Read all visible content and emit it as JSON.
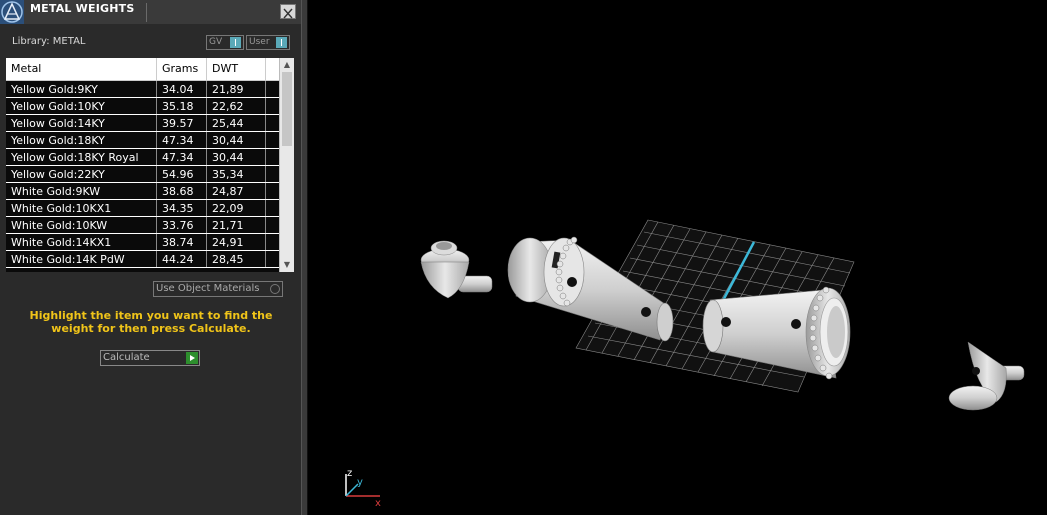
{
  "panel": {
    "title": "METAL WEIGHTS",
    "library_label": "Library: METAL",
    "toggles": [
      "GV",
      "User"
    ],
    "use_object_materials": "Use Object Materials",
    "hint": "Highlight the item you want to find the weight for then press Calculate.",
    "calculate_label": "Calculate"
  },
  "table": {
    "columns": [
      "Metal",
      "Grams",
      "DWT"
    ],
    "rows": [
      [
        "Yellow Gold:9KY",
        "34.04",
        "21,89"
      ],
      [
        "Yellow Gold:10KY",
        "35.18",
        "22,62"
      ],
      [
        "Yellow Gold:14KY",
        "39.57",
        "25,44"
      ],
      [
        "Yellow Gold:18KY",
        "47.34",
        "30,44"
      ],
      [
        "Yellow Gold:18KY Royal",
        "47.34",
        "30,44"
      ],
      [
        "Yellow Gold:22KY",
        "54.96",
        "35,34"
      ],
      [
        "White Gold:9KW",
        "38.68",
        "24,87"
      ],
      [
        "White Gold:10KX1",
        "34.35",
        "22,09"
      ],
      [
        "White Gold:10KW",
        "33.76",
        "21,71"
      ],
      [
        "White Gold:14KX1",
        "38.74",
        "24,91"
      ],
      [
        "White Gold:14K PdW",
        "44.24",
        "28,45"
      ]
    ]
  },
  "viewport": {
    "axis_labels": {
      "x": "x",
      "y": "y",
      "z": "z"
    },
    "colors": {
      "axis_x": "#d83c3c",
      "axis_y": "#3cb8d8",
      "axis_z": "#ffffff",
      "grid": "#8a8a8a",
      "model": "#cfcfcf"
    }
  }
}
